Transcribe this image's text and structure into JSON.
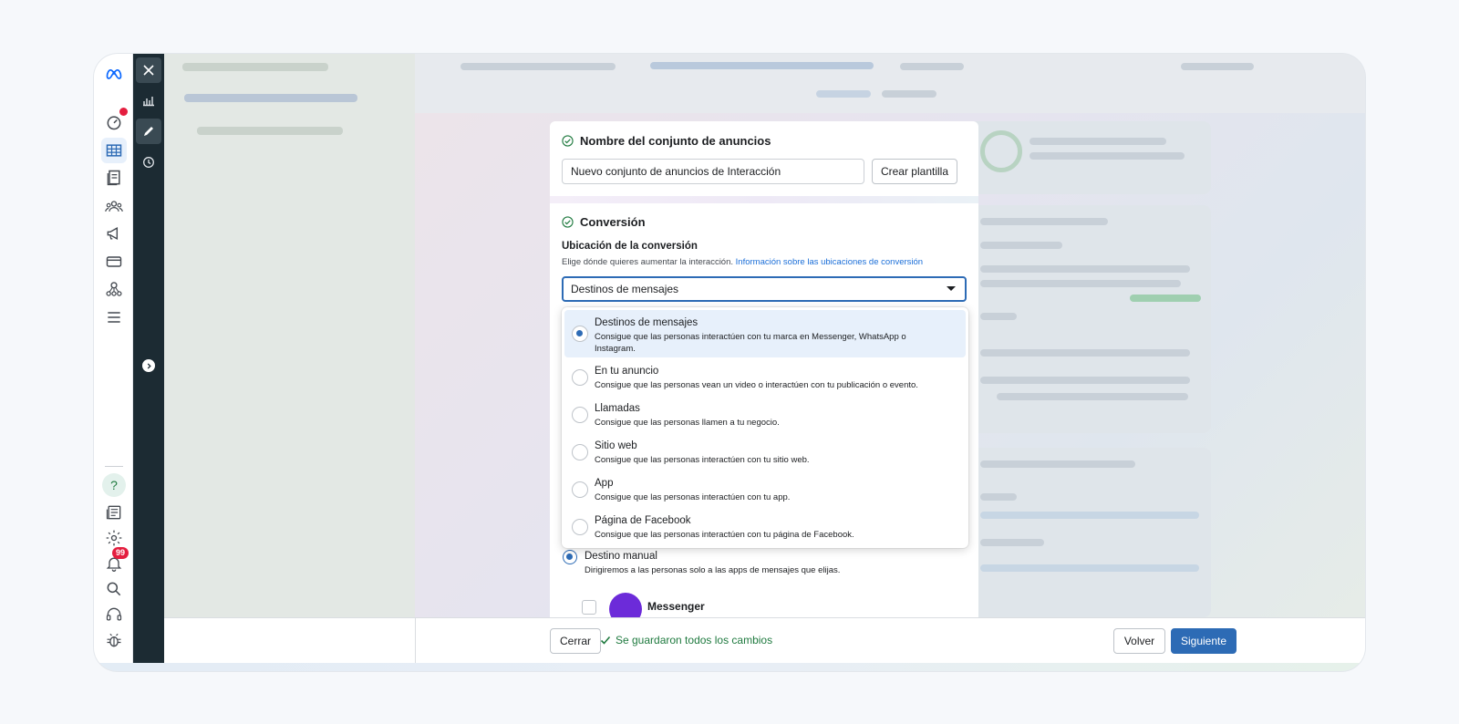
{
  "window": {
    "title": ""
  },
  "rail": {
    "notifications_count": "99"
  },
  "adset_name_section": {
    "title": "Nombre del conjunto de anuncios",
    "name_value": "Nuevo conjunto de anuncios de Interacción",
    "template_button": "Crear plantilla"
  },
  "conversion_section": {
    "title": "Conversión",
    "location_label": "Ubicación de la conversión",
    "helper_text": "Elige dónde quieres aumentar la interacción.",
    "helper_link": "Información sobre las ubicaciones de conversión",
    "selected_value": "Destinos de mensajes"
  },
  "dropdown": {
    "options": [
      {
        "title": "Destinos de mensajes",
        "desc": "Consigue que las personas interactúen con tu marca en Messenger, WhatsApp o Instagram.",
        "selected": true
      },
      {
        "title": "En tu anuncio",
        "desc": "Consigue que las personas vean un video o interactúen con tu publicación o evento.",
        "selected": false
      },
      {
        "title": "Llamadas",
        "desc": "Consigue que las personas llamen a tu negocio.",
        "selected": false
      },
      {
        "title": "Sitio web",
        "desc": "Consigue que las personas interactúen con tu sitio web.",
        "selected": false
      },
      {
        "title": "App",
        "desc": "Consigue que las personas interactúen con tu app.",
        "selected": false
      },
      {
        "title": "Página de Facebook",
        "desc": "Consigue que las personas interactúen con tu página de Facebook.",
        "selected": false
      }
    ]
  },
  "manual_destination": {
    "title": "Destino manual",
    "desc": "Dirigiremos a las personas solo a las apps de mensajes que elijas.",
    "messenger_label": "Messenger"
  },
  "bottombar": {
    "close_label": "Cerrar",
    "saved_text": "Se guardaron todos los cambios",
    "back_label": "Volver",
    "next_label": "Siguiente"
  },
  "colors": {
    "accent": "#2d6bb5",
    "link": "#1a6ed8",
    "saved_green": "#1f7a3f",
    "tool_strip": "#1c2b33",
    "badge_red": "#e41e3f"
  },
  "icons": [
    "meta-logo-icon",
    "close-icon",
    "reports-icon",
    "edit-icon",
    "history-icon",
    "dashboard-icon",
    "table-icon",
    "catalog-icon",
    "audiences-icon",
    "megaphone-icon",
    "billing-icon",
    "business-icon",
    "menu-icon",
    "help-icon",
    "news-icon",
    "gear-icon",
    "bell-icon",
    "search-icon",
    "headset-icon",
    "bug-icon",
    "expand-chevron-icon",
    "check-circle-icon"
  ]
}
